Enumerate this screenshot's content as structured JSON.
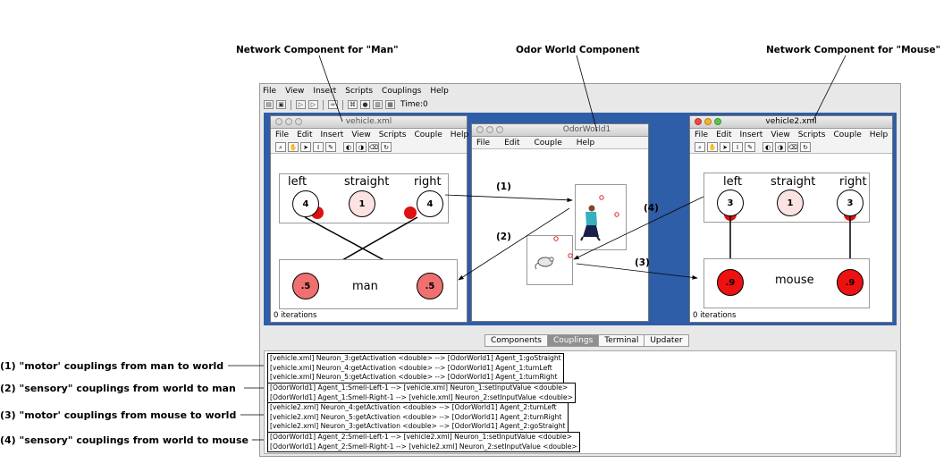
{
  "callouts": {
    "man": "Network Component for \"Man\"",
    "odor": "Odor World  Component",
    "mouse": "Network Component for \"Mouse\"",
    "left": [
      "(1) \"motor' couplings from man to world",
      "(2) \"sensory\" couplings from  world to man",
      "(3) \"motor' couplings from mouse to world",
      "(4) \"sensory\" couplings from world to mouse"
    ]
  },
  "app": {
    "menu": [
      "File",
      "View",
      "Insert",
      "Scripts",
      "Couplings",
      "Help"
    ],
    "time_label": "Time:0"
  },
  "vehicle": {
    "title": "vehicle.xml",
    "menu": [
      "File",
      "Edit",
      "Insert",
      "View",
      "Scripts",
      "Couple",
      "Help"
    ],
    "labels": [
      "left",
      "straight",
      "right"
    ],
    "values": [
      "4",
      "1",
      "4"
    ],
    "out_values": [
      ".5",
      ".5"
    ],
    "group_label": "man",
    "status": "0 iterations"
  },
  "odor": {
    "title": "OdorWorld1",
    "menu": [
      "File",
      "Edit",
      "Couple",
      "Help"
    ]
  },
  "vehicle2": {
    "title": "vehicle2.xml",
    "menu": [
      "File",
      "Edit",
      "Insert",
      "View",
      "Scripts",
      "Couple",
      "Help"
    ],
    "labels": [
      "left",
      "straight",
      "right"
    ],
    "values": [
      "3",
      "1",
      "3"
    ],
    "out_values": [
      ".9",
      ".9"
    ],
    "group_label": "mouse",
    "status": "0 iterations"
  },
  "arrows": [
    "(1)",
    "(2)",
    "(3)",
    "(4)"
  ],
  "tabs": [
    "Components",
    "Couplings",
    "Terminal",
    "Updater"
  ],
  "couplings": [
    [
      "[vehicle.xml] Neuron_3:getActivation <double> --> [OdorWorld1] Agent_1:goStraight",
      "[vehicle.xml] Neuron_4:getActivation <double> --> [OdorWorld1] Agent_1:turnLeft",
      "[vehicle.xml] Neuron_5:getActivation <double> --> [OdorWorld1] Agent_1:turnRight"
    ],
    [
      "[OdorWorld1] Agent_1:Smell-Left-1 --> [vehicle.xml] Neuron_1:setInputValue <double>",
      "[OdorWorld1] Agent_1:Smell-Right-1 --> [vehicle.xml] Neuron_2:setInputValue <double>"
    ],
    [
      "[vehicle2.xml] Neuron_4:getActivation <double> --> [OdorWorld1] Agent_2:turnLeft",
      "[vehicle2.xml] Neuron_5:getActivation <double> --> [OdorWorld1] Agent_2:turnRight",
      "[vehicle2.xml] Neuron_3:getActivation <double> --> [OdorWorld1] Agent_2:goStraight"
    ],
    [
      "[OdorWorld1] Agent_2:Smell-Left-1 --> [vehicle2.xml] Neuron_1:setInputValue <double>",
      "[OdorWorld1] Agent_2:Smell-Right-1 --> [vehicle2.xml] Neuron_2:setInputValue <double>"
    ]
  ],
  "colors": {
    "desktop": "#2f5ea8",
    "input_neuron": "#fde2e2",
    "output_man": "#f07070",
    "output_mouse": "#ee1111",
    "activation_dot": "#dd1111"
  }
}
